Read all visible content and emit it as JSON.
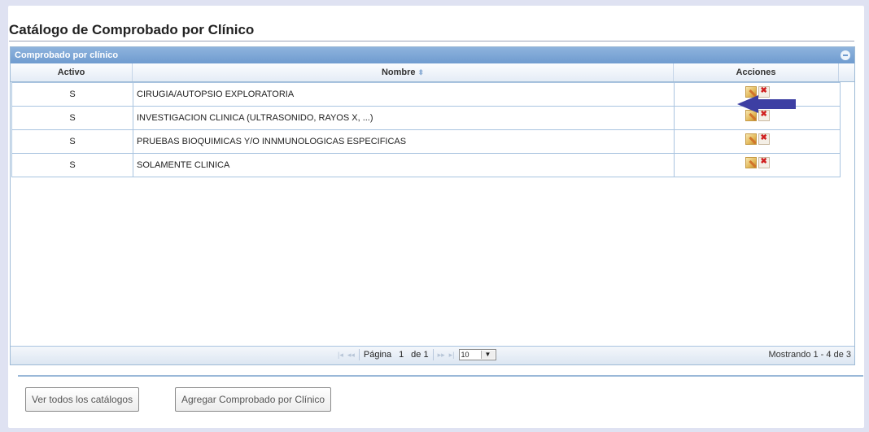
{
  "page": {
    "title": "Catálogo de Comprobado por Clínico"
  },
  "grid": {
    "caption": "Comprobado por clínico",
    "columns": {
      "activo": "Activo",
      "nombre": "Nombre",
      "acciones": "Acciones"
    },
    "rows": [
      {
        "activo": "S",
        "nombre": "CIRUGIA/AUTOPSIO EXPLORATORIA"
      },
      {
        "activo": "S",
        "nombre": "INVESTIGACION CLINICA (ULTRASONIDO, RAYOS X, ...)"
      },
      {
        "activo": "S",
        "nombre": "PRUEBAS BIOQUIMICAS Y/O INNMUNOLOGICAS ESPECIFICAS"
      },
      {
        "activo": "S",
        "nombre": "SOLAMENTE CLINICA"
      }
    ],
    "pager": {
      "page_label": "Página",
      "page_value": "1",
      "of_label": "de 1",
      "rows_per_page": "10",
      "record_info": "Mostrando 1 - 4 de 3"
    }
  },
  "buttons": {
    "view_all": "Ver todos los catálogos",
    "add": "Agregar Comprobado por Clínico"
  },
  "colors": {
    "caption": "#7aa3d6",
    "annotation_arrow": "#3d3fa3"
  }
}
